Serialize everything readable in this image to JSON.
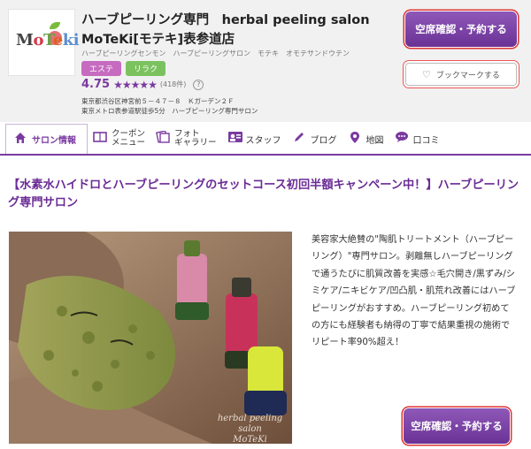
{
  "header": {
    "salon_name_line1": "ハーブピーリング専門　herbal peeling salon",
    "salon_name_line2": "MoTeKi[モテキ]表参道店",
    "salon_kana": "ハーブピーリングセンモン　ハーブピーリングサロン　モテキ　オモテサンドウテン",
    "tags": [
      "エステ",
      "リラク"
    ],
    "rating": "4.75",
    "stars": "★★★★★",
    "review_count": "(418件)",
    "help": "?",
    "address_line1": "東京都渋谷区神宮前５－４７－８　Ｋガーデン２Ｆ",
    "address_line2": "東京メトロ表参道駅徒歩5分　ハーブピーリング専門サロン",
    "reserve_label": "空席確認・予約する",
    "bookmark_label": "ブックマークする"
  },
  "nav": [
    {
      "label": "サロン情報",
      "icon": "home-icon"
    },
    {
      "label": "クーポン\nメニュー",
      "icon": "coupon-icon"
    },
    {
      "label": "フォト\nギャラリー",
      "icon": "photo-icon"
    },
    {
      "label": "スタッフ",
      "icon": "staff-icon"
    },
    {
      "label": "ブログ",
      "icon": "pencil-icon"
    },
    {
      "label": "地図",
      "icon": "map-pin-icon"
    },
    {
      "label": "口コミ",
      "icon": "chat-icon"
    }
  ],
  "content": {
    "headline": "【水素水ハイドロとハーブピーリングのセットコース初回半額キャンペーン中！】ハーブピーリング専門サロン",
    "description": "美容家大絶賛の\"陶肌トリートメント（ハーブピーリング）\"専門サロン。剥離無しハーブピーリングで通うたびに肌質改善を実感☆毛穴開き/黒ずみ/シミケア/ニキビケア/凹凸肌・肌荒れ改善にはハーブピーリングがおすすめ。ハーブピーリング初めての方にも経験者も納得の丁寧で結果重視の施術でリピート率90%超え！",
    "photo_watermark_line1": "herbal peeling salon",
    "photo_watermark_line2": "MoTeKi",
    "reserve_label": "空席確認・予約する"
  },
  "colors": {
    "accent": "#7a3aa0",
    "tag_esthe": "#c66bc0",
    "tag_relax": "#7bc25f"
  }
}
